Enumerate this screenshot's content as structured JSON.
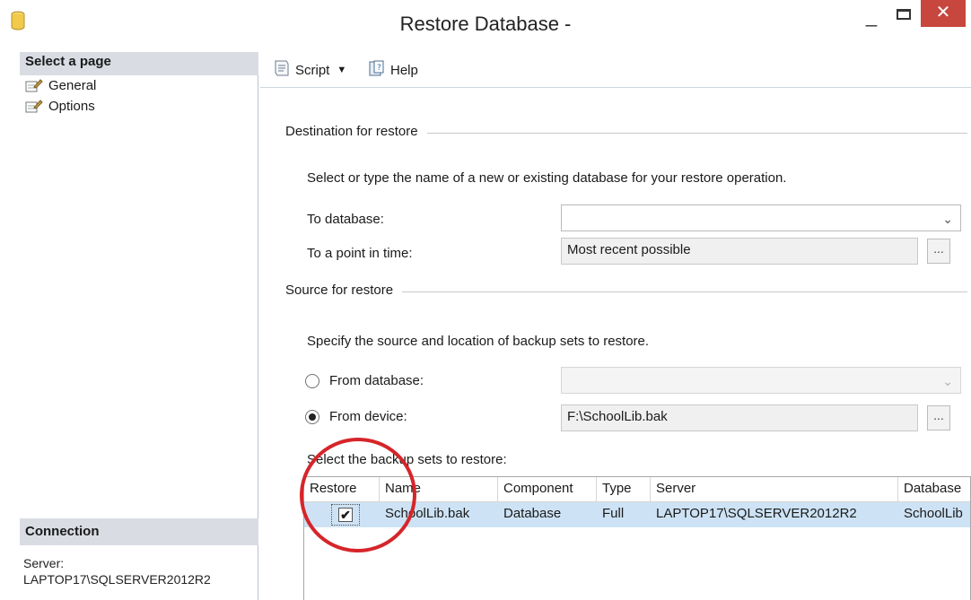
{
  "window": {
    "title": "Restore Database -",
    "minimize_glyph": "_",
    "close_glyph": "✕"
  },
  "left_pane": {
    "header": "Select a page",
    "pages": [
      {
        "label": "General",
        "icon": "wrench-page-icon"
      },
      {
        "label": "Options",
        "icon": "wrench-page-icon"
      }
    ],
    "connection_header": "Connection",
    "server_label": "Server:",
    "server_value": "LAPTOP17\\SQLSERVER2012R2"
  },
  "toolbar": {
    "script_label": "Script",
    "help_label": "Help"
  },
  "destination": {
    "group_title": "Destination for restore",
    "description": "Select or type the name of a new or existing database for your restore operation.",
    "to_database_label": "To database:",
    "to_database_value": "",
    "point_in_time_label": "To a point in time:",
    "point_in_time_value": "Most recent possible",
    "browse_label": "..."
  },
  "source": {
    "group_title": "Source for restore",
    "description": "Specify the source and location of backup sets to restore.",
    "from_database_label": "From database:",
    "from_database_selected": false,
    "from_device_label": "From device:",
    "from_device_selected": true,
    "device_value": "F:\\SchoolLib.bak",
    "browse_label": "..."
  },
  "backup_sets": {
    "label": "Select the backup sets to restore:",
    "columns": [
      "Restore",
      "Name",
      "Component",
      "Type",
      "Server",
      "Database"
    ],
    "rows": [
      {
        "restore": true,
        "name": "SchoolLib.bak",
        "component": "Database",
        "type": "Full",
        "server": "LAPTOP17\\SQLSERVER2012R2",
        "database": "SchoolLib"
      }
    ]
  },
  "annotation": {
    "color": "#d6252a"
  }
}
